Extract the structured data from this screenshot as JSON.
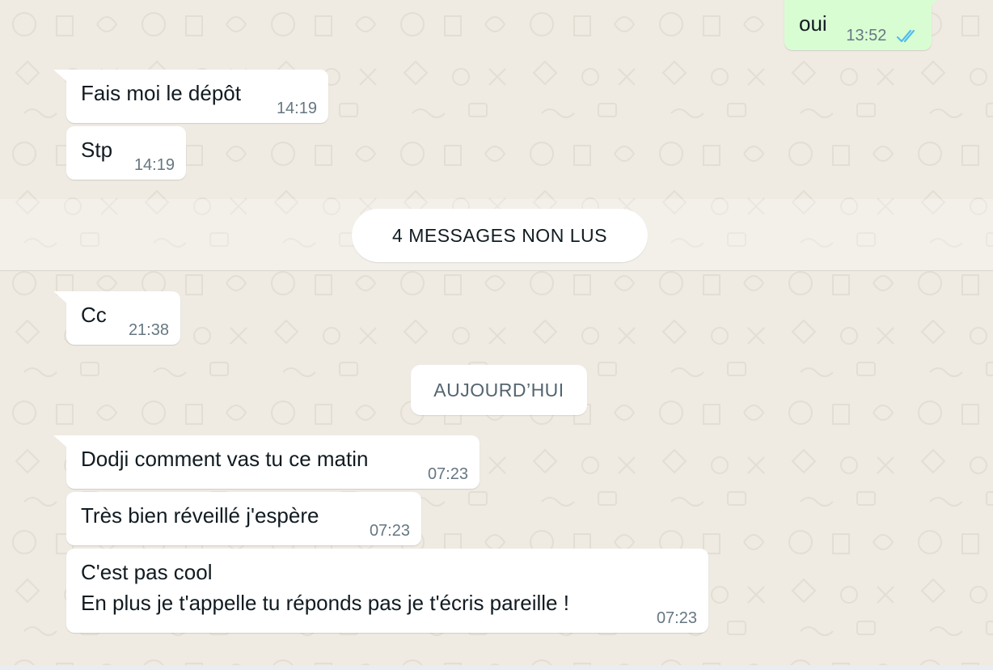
{
  "theme": {
    "background": "#efeae2",
    "incoming_bubble": "#ffffff",
    "outgoing_bubble": "#d9fdd3",
    "read_tick_color": "#53bdeb",
    "meta_color": "#667781"
  },
  "messages": {
    "m1": {
      "direction": "outgoing",
      "text": "oui",
      "time": "13:52",
      "status": "read",
      "status_icon": "double-check-icon"
    },
    "m2": {
      "direction": "incoming",
      "text": "Fais moi le dépôt",
      "time": "14:19"
    },
    "m3": {
      "direction": "incoming",
      "text": "Stp",
      "time": "14:19"
    },
    "m4": {
      "direction": "incoming",
      "text": "Cc",
      "time": "21:38"
    },
    "m5": {
      "direction": "incoming",
      "text": "Dodji comment vas tu ce matin",
      "time": "07:23"
    },
    "m6": {
      "direction": "incoming",
      "text": "Très bien réveillé j'espère",
      "time": "07:23"
    },
    "m7": {
      "direction": "incoming",
      "text_line1": "C'est pas cool",
      "text_line2": "En plus je t'appelle tu réponds pas je t'écris pareille !",
      "time": "07:23"
    }
  },
  "separators": {
    "unread": "4 MESSAGES NON LUS",
    "date": "AUJOURD’HUI"
  }
}
